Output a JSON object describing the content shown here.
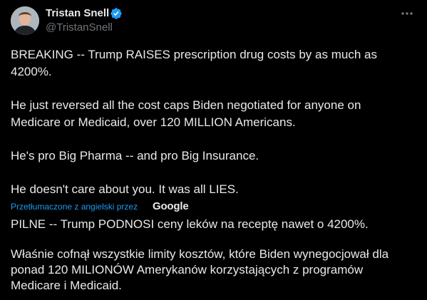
{
  "author": {
    "display_name": "Tristan Snell",
    "handle": "@TristanSnell",
    "verified": true,
    "verified_color": "#1d9bf0"
  },
  "menu": {
    "more_icon": "more-horizontal-icon"
  },
  "tweet": {
    "paragraphs": [
      "BREAKING -- Trump RAISES prescription drug costs by as much as\n4200%.",
      "He just reversed all the cost caps Biden negotiated for anyone on\nMedicare or Medicaid, over 120 MILLION Americans.",
      "He's pro Big Pharma -- and pro Big Insurance.",
      "He doesn't care about you.  It was all LIES."
    ]
  },
  "translation": {
    "label": "Przetłumaczone z angielski przez",
    "provider": "Google",
    "link_color": "#1d9bf0",
    "paragraphs": [
      "PILNE -- Trump PODNOSI ceny leków na receptę nawet o 4200%.",
      "Właśnie cofnął wszystkie limity kosztów, które Biden wynegocjował dla\nponad 120 MILIONÓW Amerykanów korzystających z programów\nMedicare i Medicaid."
    ]
  },
  "colors": {
    "background": "#000000",
    "text": "#e7e9ea",
    "secondary": "#71767b"
  }
}
